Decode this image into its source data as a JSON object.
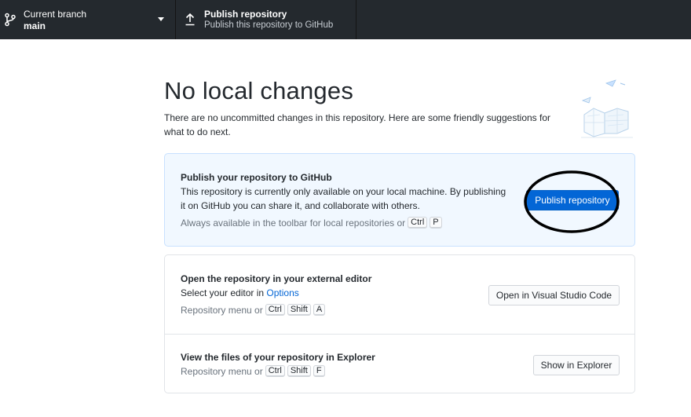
{
  "toolbar": {
    "branch": {
      "label": "Current branch",
      "value": "main"
    },
    "publish": {
      "label": "Publish repository",
      "description": "Publish this repository to GitHub"
    }
  },
  "main": {
    "title": "No local changes",
    "description": "There are no uncommitted changes in this repository. Here are some friendly suggestions for what to do next."
  },
  "cards": {
    "publish": {
      "title": "Publish your repository to GitHub",
      "text": "This repository is currently only available on your local machine. By publishing it on GitHub you can share it, and collaborate with others.",
      "hint": "Always available in the toolbar for local repositories or",
      "keys": [
        "Ctrl",
        "P"
      ],
      "button": "Publish repository"
    },
    "editor": {
      "title": "Open the repository in your external editor",
      "text_prefix": "Select your editor in",
      "link": "Options",
      "hint": "Repository menu or",
      "keys": [
        "Ctrl",
        "Shift",
        "A"
      ],
      "button": "Open in Visual Studio Code"
    },
    "explorer": {
      "title": "View the files of your repository in Explorer",
      "hint": "Repository menu or",
      "keys": [
        "Ctrl",
        "Shift",
        "F"
      ],
      "button": "Show in Explorer"
    }
  },
  "colors": {
    "toolbar_bg": "#24292e",
    "primary_button": "#0366d6",
    "publish_card_bg": "#f1f8ff",
    "annotation": "#000000"
  },
  "icons": {
    "branch": "git-branch-icon",
    "publish": "upload-icon",
    "caret": "chevron-down-icon",
    "illustration": "empty-state-illustration"
  }
}
